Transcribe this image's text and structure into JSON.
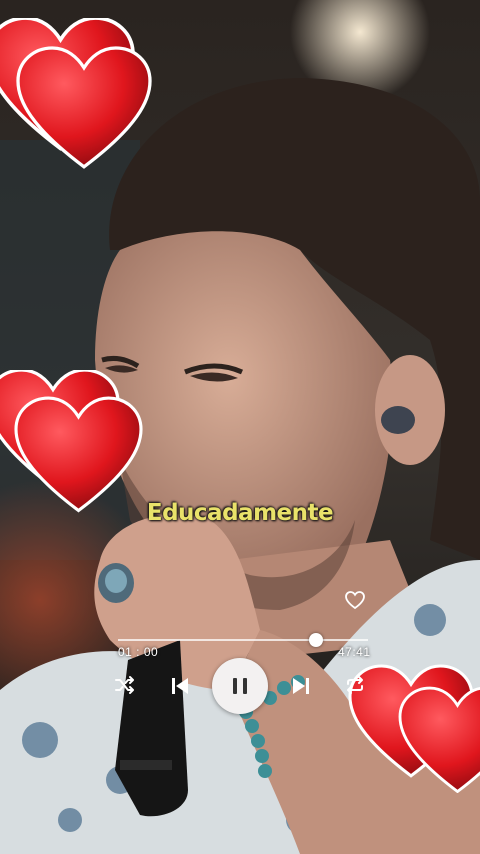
{
  "lyric": {
    "text": "Educadamente"
  },
  "player": {
    "current_time": "01 : 00",
    "total_time": "47:41",
    "progress": 0.79,
    "state": "playing",
    "controls": [
      "shuffle-icon",
      "previous-icon",
      "pause-icon",
      "next-icon",
      "repeat-icon"
    ],
    "like_icon": "heart-outline-icon"
  },
  "colors": {
    "lyric": "#e9e26a",
    "track": "#ffffff",
    "play_button": "#f3f1f1",
    "sticker_heart": "#e21b22"
  }
}
